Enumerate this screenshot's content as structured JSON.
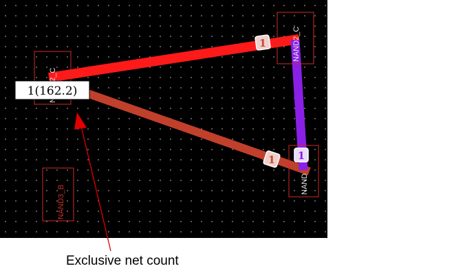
{
  "layout_canvas": {
    "cells": [
      {
        "id": "top-left",
        "label": "NAND2_C"
      },
      {
        "id": "top-right",
        "label": "NAND2_C"
      },
      {
        "id": "bottom-left",
        "label": "NAND3_B"
      },
      {
        "id": "bottom-right",
        "label": "NAND"
      }
    ],
    "wires": [
      {
        "id": "top-wire",
        "color": "#ff1a1a"
      },
      {
        "id": "diagonal-wire",
        "color": "#c0402c"
      },
      {
        "id": "vertical-wire",
        "color": "#8a1fe6"
      }
    ],
    "badges": [
      "1",
      "1",
      "1"
    ],
    "net_count_label": "1(162.2)"
  },
  "annotation": {
    "caption": "Exclusive net count",
    "color": "#e00000"
  }
}
